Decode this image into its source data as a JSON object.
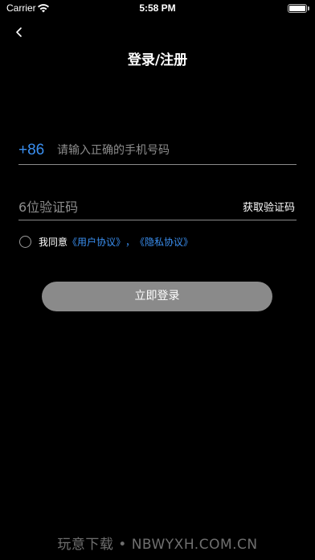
{
  "status_bar": {
    "carrier": "Carrier",
    "time": "5:58 PM",
    "wifi_icon": "wifi-icon",
    "battery_icon": "battery-icon",
    "battery_level": 1.0
  },
  "nav": {
    "back_icon": "chevron-left-icon",
    "title": "登录/注册"
  },
  "form": {
    "country_code": "+86",
    "phone_placeholder": "请输入正确的手机号码",
    "phone_value": "",
    "code_placeholder": "6位验证码",
    "code_value": "",
    "get_code_label": "获取验证码"
  },
  "agreement": {
    "checked": false,
    "prefix": "我同意",
    "user_agreement": "《用户协议》",
    "separator": "，",
    "privacy_agreement": "《隐私协议》"
  },
  "login_button_label": "立即登录",
  "watermark": "玩意下载 • NBWYXH.COM.CN",
  "colors": {
    "background": "#000000",
    "accent": "#3a8ff0",
    "button": "#8a8a8a",
    "placeholder": "#8d8d8d"
  }
}
